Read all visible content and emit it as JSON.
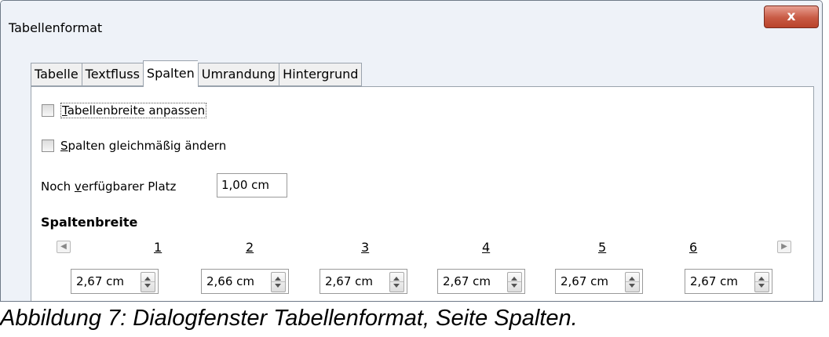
{
  "window": {
    "title": "Tabellenformat",
    "close_label": "x"
  },
  "tabs": [
    {
      "label": "Tabelle",
      "active": false
    },
    {
      "label": "Textfluss",
      "active": false
    },
    {
      "label": "Spalten",
      "active": true
    },
    {
      "label": "Umrandung",
      "active": false
    },
    {
      "label": "Hintergrund",
      "active": false
    }
  ],
  "options": {
    "adapt_width": {
      "mnemonic": "T",
      "rest": "abellenbreite anpassen",
      "checked": false
    },
    "equal_columns": {
      "mnemonic": "S",
      "rest": "palten gleichmäßig ändern",
      "checked": false
    }
  },
  "space": {
    "label_pre": "Noch ",
    "mnemonic": "v",
    "label_post": "erfügbarer Platz",
    "value": "1,00 cm"
  },
  "column_width": {
    "title": "Spaltenbreite",
    "columns": [
      {
        "number": "1",
        "value": "2,67 cm"
      },
      {
        "number": "2",
        "value": "2,66 cm"
      },
      {
        "number": "3",
        "value": "2,67 cm"
      },
      {
        "number": "4",
        "value": "2,67 cm"
      },
      {
        "number": "5",
        "value": "2,67 cm"
      },
      {
        "number": "6",
        "value": "2,67 cm"
      }
    ]
  },
  "caption": "Abbildung 7: Dialogfenster Tabellenformat, Seite Spalten."
}
